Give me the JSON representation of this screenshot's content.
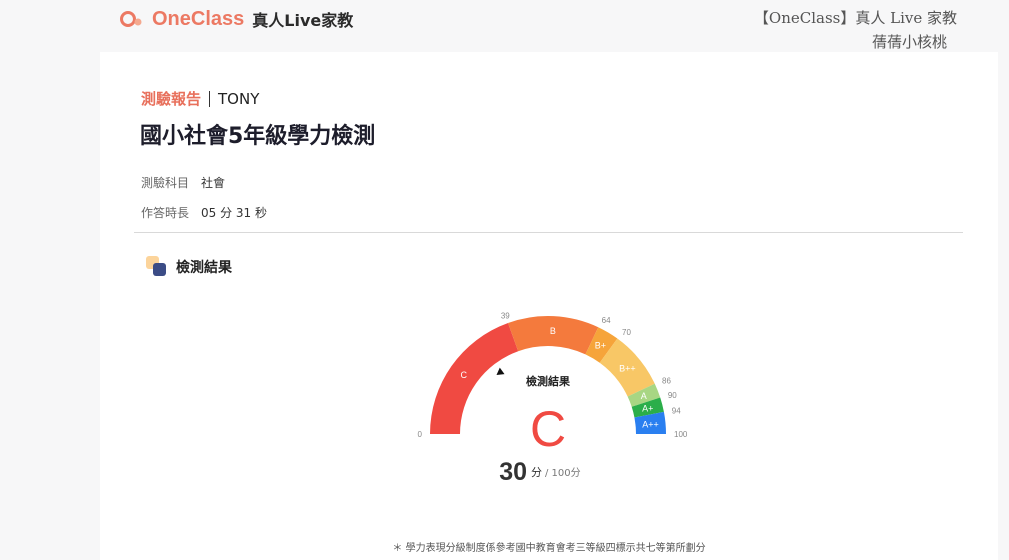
{
  "header": {
    "brand": "OneClass",
    "brand_sub": "真人Live家教",
    "watermark_line1": "【OneClass】真人 Live 家教",
    "watermark_line2": "蒨蒨小核桃"
  },
  "report": {
    "label": "測驗報告",
    "student": "TONY",
    "title": "國小社會5年級學力檢測",
    "subject_key": "測驗科目",
    "subject_value": "社會",
    "duration_key": "作答時長",
    "duration_value": "05 分 31 秒"
  },
  "result": {
    "section_title": "檢測結果",
    "gauge_title": "檢測結果",
    "grade": "C",
    "score": "30",
    "score_unit": "分",
    "score_total": "/ 100分",
    "score_value": 30,
    "bands": [
      {
        "label": "C",
        "from": 0,
        "to": 39,
        "color": "#f04a42"
      },
      {
        "label": "B",
        "from": 39,
        "to": 64,
        "color": "#f47a3d"
      },
      {
        "label": "B+",
        "from": 64,
        "to": 70,
        "color": "#f6a43a"
      },
      {
        "label": "B++",
        "from": 70,
        "to": 86,
        "color": "#f8c766"
      },
      {
        "label": "A",
        "from": 86,
        "to": 90,
        "color": "#a8d683"
      },
      {
        "label": "A+",
        "from": 90,
        "to": 94,
        "color": "#2bae4a"
      },
      {
        "label": "A++",
        "from": 94,
        "to": 100,
        "color": "#2a7ff0"
      }
    ],
    "ticks": [
      "0",
      "39",
      "64",
      "70",
      "86",
      "90",
      "94",
      "100"
    ]
  },
  "footnote": "＊ 學力表現分級制度係參考國中教育會考三等級四標示共七等第所劃分",
  "colors": {
    "accent": "#e8705c",
    "grade": "#f04a42"
  }
}
